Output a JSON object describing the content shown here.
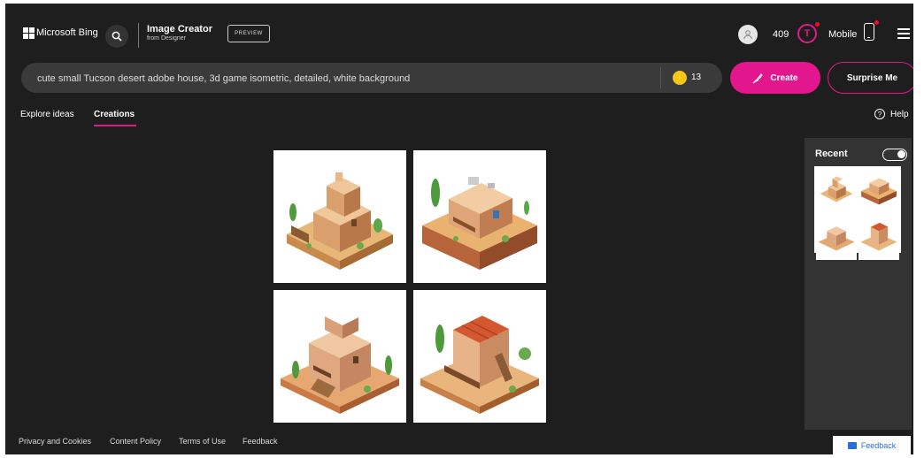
{
  "header": {
    "brand": "Microsoft Bing",
    "product_title": "Image Creator",
    "product_subtitle": "from Designer",
    "preview_badge": "PREVIEW",
    "rewards_points": "409",
    "mobile_label": "Mobile"
  },
  "prompt": {
    "value": "cute small Tucson desert adobe house, 3d game isometric, detailed, white background",
    "boosts": "13"
  },
  "actions": {
    "create_label": "Create",
    "surprise_label": "Surprise Me"
  },
  "tabs": [
    {
      "label": "Explore ideas",
      "active": false
    },
    {
      "label": "Creations",
      "active": true
    }
  ],
  "help_label": "Help",
  "recent": {
    "label": "Recent",
    "toggle_on": true
  },
  "results": [
    {
      "subject": "adobe-house-1"
    },
    {
      "subject": "adobe-house-2"
    },
    {
      "subject": "adobe-house-3"
    },
    {
      "subject": "adobe-house-4"
    }
  ],
  "footer": {
    "links": [
      "Privacy and Cookies",
      "Content Policy",
      "Terms of Use",
      "Feedback"
    ],
    "feedback_button": "Feedback"
  },
  "colors": {
    "accent": "#e3178d",
    "background": "#1e1e1e",
    "panel": "#333333"
  }
}
